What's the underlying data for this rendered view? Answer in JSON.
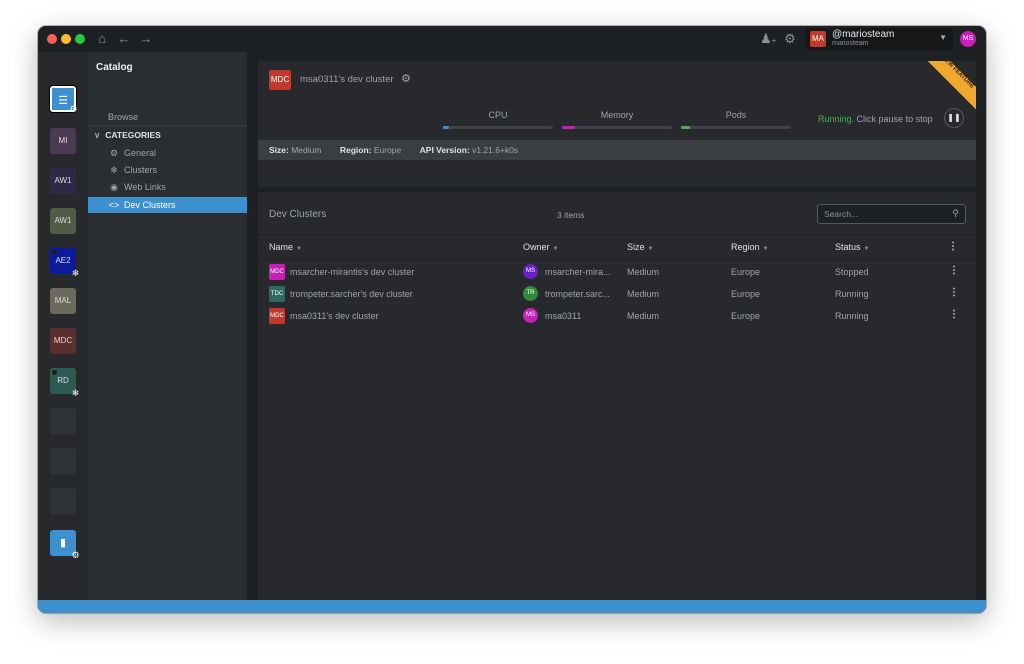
{
  "topbar": {
    "home_icon": "home-icon",
    "back_icon": "arrow-left-icon",
    "forward_icon": "arrow-right-icon",
    "add_user_icon": "add-user-icon",
    "settings_icon": "gear-icon",
    "user": {
      "avatar": "MA",
      "name": "@mariosteam",
      "handle": "mariosteam"
    },
    "profile_avatar": "MS"
  },
  "hotbar": {
    "items": [
      {
        "label": "",
        "icon": "catalog-icon",
        "color": "#3d90ce"
      },
      {
        "label": "MI",
        "color": "#4c3a55"
      },
      {
        "label": "AW1",
        "color": "#2e2a45"
      },
      {
        "label": "AW1",
        "color": "#535a46"
      },
      {
        "label": "AE2",
        "color": "#0c1b99"
      },
      {
        "label": "MAL",
        "color": "#6b6a5c"
      },
      {
        "label": "MDC",
        "color": "#5b2f2d"
      },
      {
        "label": "RD",
        "color": "#2e5a54"
      }
    ],
    "page": "1"
  },
  "sidebar": {
    "title": "Catalog",
    "browse": "Browse",
    "categories_label": "CATEGORIES",
    "items": [
      {
        "label": "General",
        "icon": "gear-icon"
      },
      {
        "label": "Clusters",
        "icon": "cluster-icon"
      },
      {
        "label": "Web Links",
        "icon": "globe-icon"
      },
      {
        "label": "Dev Clusters",
        "icon": "code-icon"
      }
    ]
  },
  "detail": {
    "badge": "MDC",
    "title": "msa0311's dev cluster",
    "ribbon": "NEW FEATURE",
    "metrics": [
      {
        "label": "CPU",
        "fill": 0.05,
        "color": "#3d90ce"
      },
      {
        "label": "Memory",
        "fill": 0.12,
        "color": "#c71fb7"
      },
      {
        "label": "Pods",
        "fill": 0.08,
        "color": "#48b155"
      }
    ],
    "status_running": "Running.",
    "status_hint": "Click pause to stop",
    "info": {
      "size_label": "Size:",
      "size_value": "Medium",
      "region_label": "Region:",
      "region_value": "Europe",
      "api_label": "API Version:",
      "api_value": "v1.21.6+k0s"
    }
  },
  "list": {
    "title": "Dev Clusters",
    "count": "3 items",
    "search_placeholder": "Search...",
    "columns": [
      "Name",
      "Owner",
      "Size",
      "Region",
      "Status"
    ],
    "rows": [
      {
        "badge": "MDC",
        "badge_color": "#c71fb7",
        "name": "msarcher-mirantis's dev cluster",
        "owner_avatar": "MS",
        "owner_color": "#6b1fc7",
        "owner": "msarcher-mira...",
        "size": "Medium",
        "region": "Europe",
        "status": "Stopped"
      },
      {
        "badge": "TDC",
        "badge_color": "#2e6a5e",
        "name": "trompeter.sarcher's dev cluster",
        "owner_avatar": "TR",
        "owner_color": "#2e8b3a",
        "owner": "trompeter.sarc...",
        "size": "Medium",
        "region": "Europe",
        "status": "Running"
      },
      {
        "badge": "MDC",
        "badge_color": "#c0392b",
        "name": "msa0311's dev cluster",
        "owner_avatar": "MS",
        "owner_color": "#c71fb7",
        "owner": "msa0311",
        "size": "Medium",
        "region": "Europe",
        "status": "Running"
      }
    ]
  }
}
